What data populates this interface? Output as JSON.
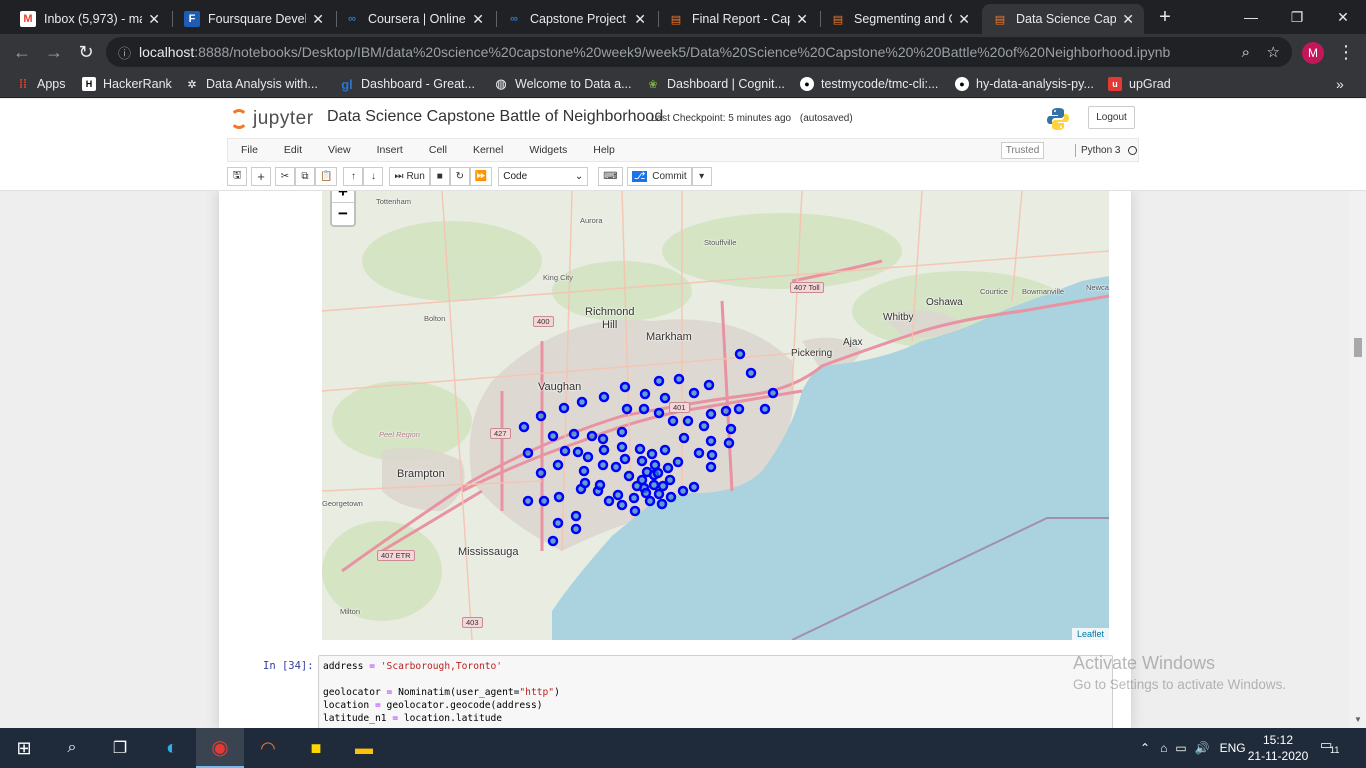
{
  "browser": {
    "tabs": [
      {
        "title": "Inbox (5,973) - ma",
        "icon": "gmail-icon"
      },
      {
        "title": "Foursquare Develo",
        "icon": "foursquare-icon"
      },
      {
        "title": "Coursera | Online C",
        "icon": "coursera-icon"
      },
      {
        "title": "Capstone Project -",
        "icon": "coursera-icon"
      },
      {
        "title": "Final Report - Cap",
        "icon": "notebook-icon"
      },
      {
        "title": "Segmenting and C",
        "icon": "notebook-icon"
      },
      {
        "title": "Data Science Caps",
        "icon": "notebook-icon",
        "active": true
      }
    ],
    "new_tab": "+",
    "address": {
      "host": "localhost",
      "path": ":8888/notebooks/Desktop/IBM/data%20science%20capstone%20week9/week5/Data%20Science%20Capstone%20%20Battle%20of%20Neighborhood.ipynb"
    },
    "profile_initial": "M",
    "bookmarks": [
      {
        "label": "Apps",
        "icon": "apps-grid-icon"
      },
      {
        "label": "HackerRank",
        "icon": "hackerrank-icon"
      },
      {
        "label": "Data Analysis with...",
        "icon": "bookmark-icon"
      },
      {
        "label": "Dashboard - Great...",
        "icon": "greatlearning-icon"
      },
      {
        "label": "Welcome to Data a...",
        "icon": "globe-icon"
      },
      {
        "label": "Dashboard | Cognit...",
        "icon": "cognitive-icon"
      },
      {
        "label": "testmycode/tmc-cli:...",
        "icon": "github-icon"
      },
      {
        "label": "hy-data-analysis-py...",
        "icon": "github-icon"
      },
      {
        "label": "upGrad",
        "icon": "upgrad-icon"
      }
    ]
  },
  "jupyter": {
    "logo_text": "jupyter",
    "notebook_title": "Data Science Capstone Battle of Neighborhood",
    "checkpoint": "Last Checkpoint: 5 minutes ago",
    "autosave": "(autosaved)",
    "logout": "Logout",
    "menu": [
      "File",
      "Edit",
      "View",
      "Insert",
      "Cell",
      "Kernel",
      "Widgets",
      "Help"
    ],
    "trusted": "Trusted",
    "kernel_name": "Python 3",
    "toolbar": {
      "run": "Run",
      "cell_type": "Code",
      "commit": "Commit"
    }
  },
  "map": {
    "zoom_in": "+",
    "zoom_out": "−",
    "attribution": "Leaflet",
    "marker_color": "#0000ff",
    "places": [
      "Tottenham",
      "Aurora",
      "Stouffville",
      "King City",
      "Richmond",
      "Hill",
      "Markham",
      "Bolton",
      "Vaughan",
      "Pickering",
      "Ajax",
      "Whitby",
      "Oshawa",
      "Courtice",
      "Bowmanville",
      "Newca",
      "Brampton",
      "Georgetown",
      "Mississauga",
      "Milton",
      "Peel Region"
    ],
    "highways": [
      "407 Toll",
      "400",
      "427",
      "401",
      "407 ETR",
      "403"
    ]
  },
  "cell": {
    "prompt": "In [34]:",
    "lines": [
      "address = 'Scarborough,Toronto'",
      "",
      "geolocator = Nominatim(user_agent=\"http\")",
      "location = geolocator.geocode(address)",
      "latitude_n1 = location.latitude"
    ]
  },
  "watermark": {
    "line1": "Activate Windows",
    "line2": "Go to Settings to activate Windows."
  },
  "taskbar": {
    "language": "ENG",
    "time": "15:12",
    "date": "21-11-2020",
    "notifications": "11"
  }
}
